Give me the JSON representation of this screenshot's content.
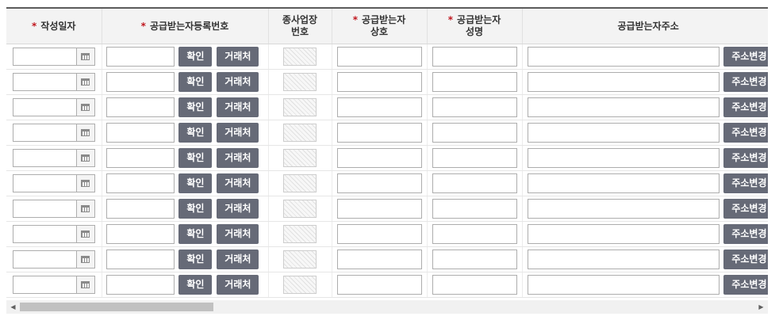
{
  "headers": {
    "required_mark": "*",
    "col_date": "작성일자",
    "col_regno": "공급받는자등록번호",
    "col_subno_line1": "종사업장",
    "col_subno_line2": "번호",
    "col_name_line1": "공급받는자",
    "col_name_line2": "상호",
    "col_rep_line1": "공급받는자",
    "col_rep_line2": "성명",
    "col_addr": "공급받는자주소"
  },
  "buttons": {
    "confirm": "확인",
    "partner": "거래처",
    "change_address": "주소변경"
  },
  "row_count": 10,
  "colors": {
    "button_bg": "#666a77",
    "header_bg": "#f3f3f3",
    "required": "#c0171f"
  },
  "icons": {
    "calendar": "calendar-icon",
    "scroll_left": "scroll-left-icon",
    "scroll_right": "scroll-right-icon"
  },
  "scroll": {
    "thumb_fraction": 0.25
  }
}
